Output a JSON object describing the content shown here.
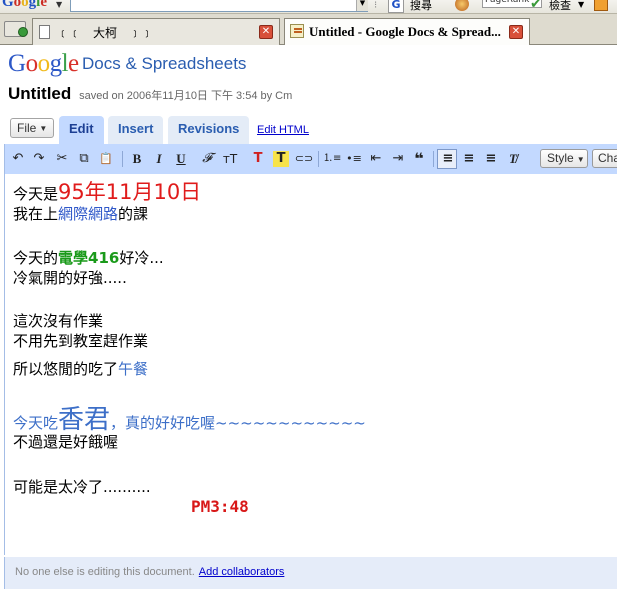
{
  "browser": {
    "logo_text": "Google",
    "search_label": "搜尋",
    "pagerank_label": "PageRank",
    "check_label": "檢查",
    "tabs": [
      {
        "label": "﹝﹝　大柯　﹞﹞",
        "active": false
      },
      {
        "label": "Untitled - Google Docs & Spread...",
        "active": true
      }
    ],
    "close_glyph": "✕"
  },
  "app": {
    "logo": "Google",
    "product": "Docs & Spreadsheets",
    "doc_title": "Untitled",
    "saved_info": "saved on 2006年11月10日 下午 3:54 by Cm"
  },
  "menu": {
    "file": "File",
    "tabs": [
      "Edit",
      "Insert",
      "Revisions"
    ],
    "active_tab": "Edit",
    "edit_html": "Edit HTML"
  },
  "toolbar": {
    "undo": "↶",
    "redo": "↷",
    "cut": "✂",
    "copy": "⧉",
    "paste": "📋",
    "bold": "B",
    "italic": "I",
    "underline": "U",
    "font": "𝓕",
    "font_size": "ᴛT",
    "text_color": "T",
    "highlight": "T",
    "link": "⊂⊃",
    "numbered_list": "⒈≡",
    "bullet_list": "•≡",
    "outdent": "⇤",
    "indent": "⇥",
    "quote": "❝",
    "align_left": "≡",
    "align_center": "≡",
    "align_right": "≡",
    "clear_format": "T̸",
    "style": "Style",
    "change": "Change"
  },
  "content": {
    "line1_prefix": "今天是",
    "line1_date": "95年11月10日",
    "line2_prefix": "我在上",
    "line2_course": "網際網路",
    "line2_suffix": "的課",
    "line3_prefix": "今天的",
    "line3_room": "電學416",
    "line3_suffix": "好冷...",
    "line4": "冷氣開的好強.....",
    "line5": "這次沒有作業",
    "line6": "不用先到教室趕作業",
    "line7_prefix": "所以悠閒的吃了",
    "line7_lunch": "午餐",
    "line8_prefix": "今天吃",
    "line8_big": "香君",
    "line8_suffix": "，真的好好吃喔~~~~~~~~~~~~",
    "line9": "不過還是好餓喔",
    "line10": "可能是太冷了..........",
    "time": "PM3:48"
  },
  "footer": {
    "status": "No one else is editing this document.",
    "add_collaborators": "Add collaborators"
  }
}
